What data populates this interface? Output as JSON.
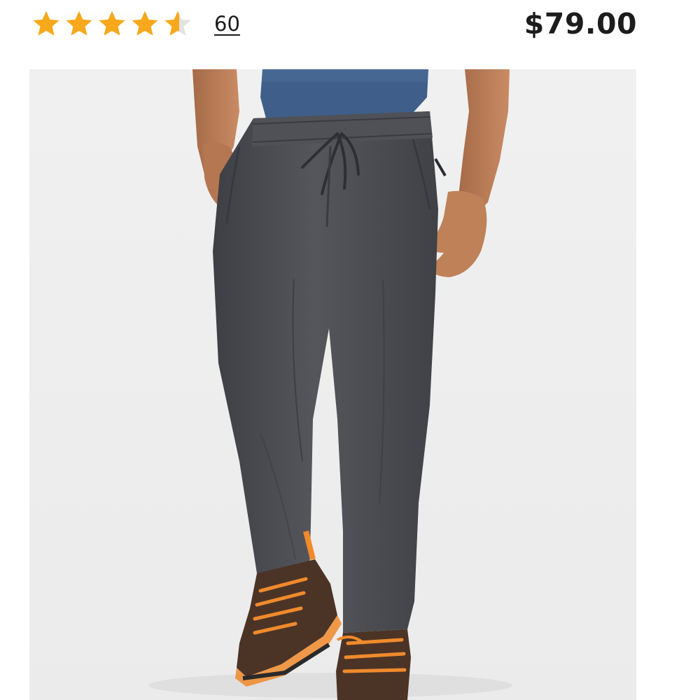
{
  "rating": {
    "value": 4.6,
    "max": 5,
    "review_count": "60",
    "star_color": "#f7a81b",
    "empty_star_color": "#e3e3e3"
  },
  "price": "$79.00",
  "product_image": {
    "icon": "product-photo-pants",
    "colors": {
      "background": "#f2f2f2",
      "pants": "#4a4b50",
      "shirt": "#3f5f8a",
      "skin": "#b97a56",
      "shoe": "#4b3426",
      "laces": "#f08a2c"
    }
  }
}
